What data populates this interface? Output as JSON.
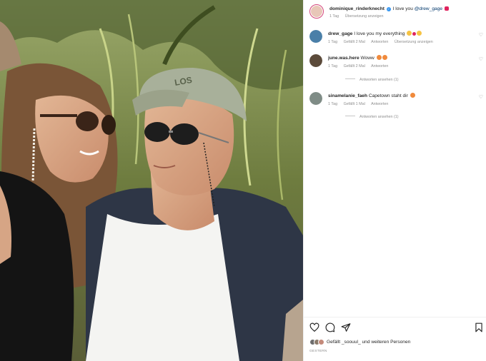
{
  "post": {
    "author": "dominique_rinderknecht",
    "caption_text": "I love you ",
    "caption_mention": "@drew_gage",
    "time": "1 Tag",
    "translate_label": "Übersetzung anzeigen"
  },
  "comments": [
    {
      "username": "drew_gage",
      "text": "I love you my everything",
      "time": "1 Tag",
      "likes": "Gefällt 2 Mal",
      "reply_label": "Antworten",
      "translate_label": "Übersetzung anzeigen",
      "view_replies": ""
    },
    {
      "username": "june.was.here",
      "text": "Woww",
      "time": "1 Tag",
      "likes": "Gefällt 2 Mal",
      "reply_label": "Antworten",
      "translate_label": "",
      "view_replies": "Antworten ansehen (1)"
    },
    {
      "username": "sinamelanie_faeh",
      "text": "Capetown staht dir",
      "time": "1 Tag",
      "likes": "Gefällt 1 Mal",
      "reply_label": "Antworten",
      "translate_label": "",
      "view_replies": "Antworten ansehen (1)"
    }
  ],
  "footer": {
    "liked_by": "Gefällt _soouul_ und weiteren Personen",
    "date": "GESTERN"
  },
  "colors": {
    "heart": "#ed4956",
    "link": "#00376b",
    "muted": "#8e8e8e",
    "verified": "#3897f0"
  },
  "icons": [
    "heart-icon",
    "comment-icon",
    "share-icon",
    "bookmark-icon",
    "verified-icon"
  ]
}
